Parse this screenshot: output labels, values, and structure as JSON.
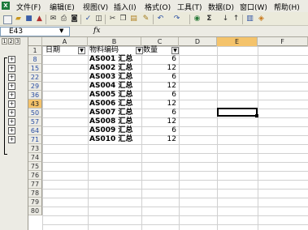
{
  "menubar": {
    "items": [
      "文件(F)",
      "编辑(E)",
      "视图(V)",
      "插入(I)",
      "格式(O)",
      "工具(T)",
      "数据(D)",
      "窗口(W)",
      "帮助(H)"
    ]
  },
  "toolbar": {
    "icons": [
      "new-icon",
      "open-icon",
      "save-icon",
      "permission-icon",
      "email-icon",
      "print-icon",
      "print-preview-icon",
      "spelling-icon",
      "research-icon",
      "cut-icon",
      "copy-icon",
      "paste-icon",
      "format-painter-icon",
      "undo-icon",
      "redo-icon",
      "hyperlink-icon",
      "autosum-icon",
      "sort-ascending-icon",
      "sort-descending-icon",
      "chart-wizard-icon",
      "drawing-icon"
    ],
    "autosum_glyph": "Σ"
  },
  "formula_bar": {
    "name_box": "E43",
    "fx": "fx",
    "formula": ""
  },
  "outline": {
    "levels": [
      "1",
      "2",
      "3"
    ],
    "expand_glyph": "+"
  },
  "columns": [
    "A",
    "B",
    "C",
    "D",
    "E",
    "F"
  ],
  "selected_column": "E",
  "header_row": {
    "row_number": "1",
    "a": "日期",
    "b": "物料编码",
    "c": "数量"
  },
  "rows": [
    {
      "num": "8",
      "code": "AS001 汇总",
      "qty": "6"
    },
    {
      "num": "15",
      "code": "AS002 汇总",
      "qty": "12"
    },
    {
      "num": "22",
      "code": "AS003 汇总",
      "qty": "6"
    },
    {
      "num": "29",
      "code": "AS004 汇总",
      "qty": "12"
    },
    {
      "num": "36",
      "code": "AS005 汇总",
      "qty": "6"
    },
    {
      "num": "43",
      "code": "AS006 汇总",
      "qty": "12"
    },
    {
      "num": "50",
      "code": "AS007 汇总",
      "qty": "6"
    },
    {
      "num": "57",
      "code": "AS008 汇总",
      "qty": "12"
    },
    {
      "num": "64",
      "code": "AS009 汇总",
      "qty": "6"
    },
    {
      "num": "71",
      "code": "AS010 汇总",
      "qty": "12"
    }
  ],
  "empty_rows": [
    "73",
    "74",
    "75",
    "76",
    "77",
    "78",
    "79",
    "80"
  ],
  "selected_row": "43"
}
